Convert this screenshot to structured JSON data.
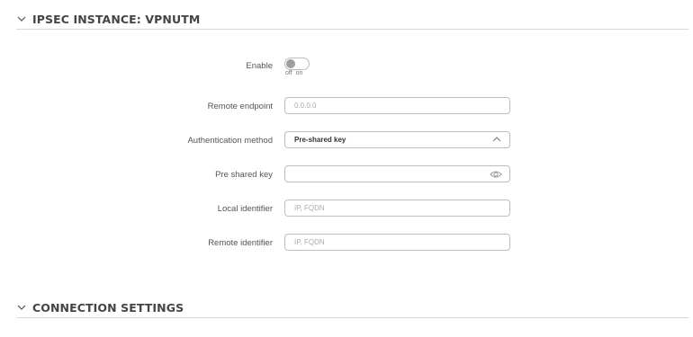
{
  "sections": {
    "ipsec_title": "IPSEC INSTANCE: VPNUTM",
    "connection_title": "CONNECTION SETTINGS"
  },
  "form": {
    "enable": {
      "label": "Enable",
      "state": "off",
      "off_label": "off",
      "on_label": "on"
    },
    "remote_endpoint": {
      "label": "Remote endpoint",
      "placeholder": "0.0.0.0",
      "value": ""
    },
    "auth_method": {
      "label": "Authentication method",
      "value": "Pre-shared key"
    },
    "pre_shared_key": {
      "label": "Pre shared key",
      "value": ""
    },
    "local_identifier": {
      "label": "Local identifier",
      "placeholder": "IP, FQDN",
      "value": ""
    },
    "remote_identifier": {
      "label": "Remote identifier",
      "placeholder": "IP, FQDN",
      "value": ""
    }
  },
  "icons": {
    "section_toggle": "chevron-down-icon",
    "select_arrow": "chevron-up-icon",
    "password_reveal": "eye-icon"
  },
  "colors": {
    "toggle_off_knob": "#9e9e9e",
    "border": "#bdbdbd",
    "divider": "#d8d8d8"
  }
}
